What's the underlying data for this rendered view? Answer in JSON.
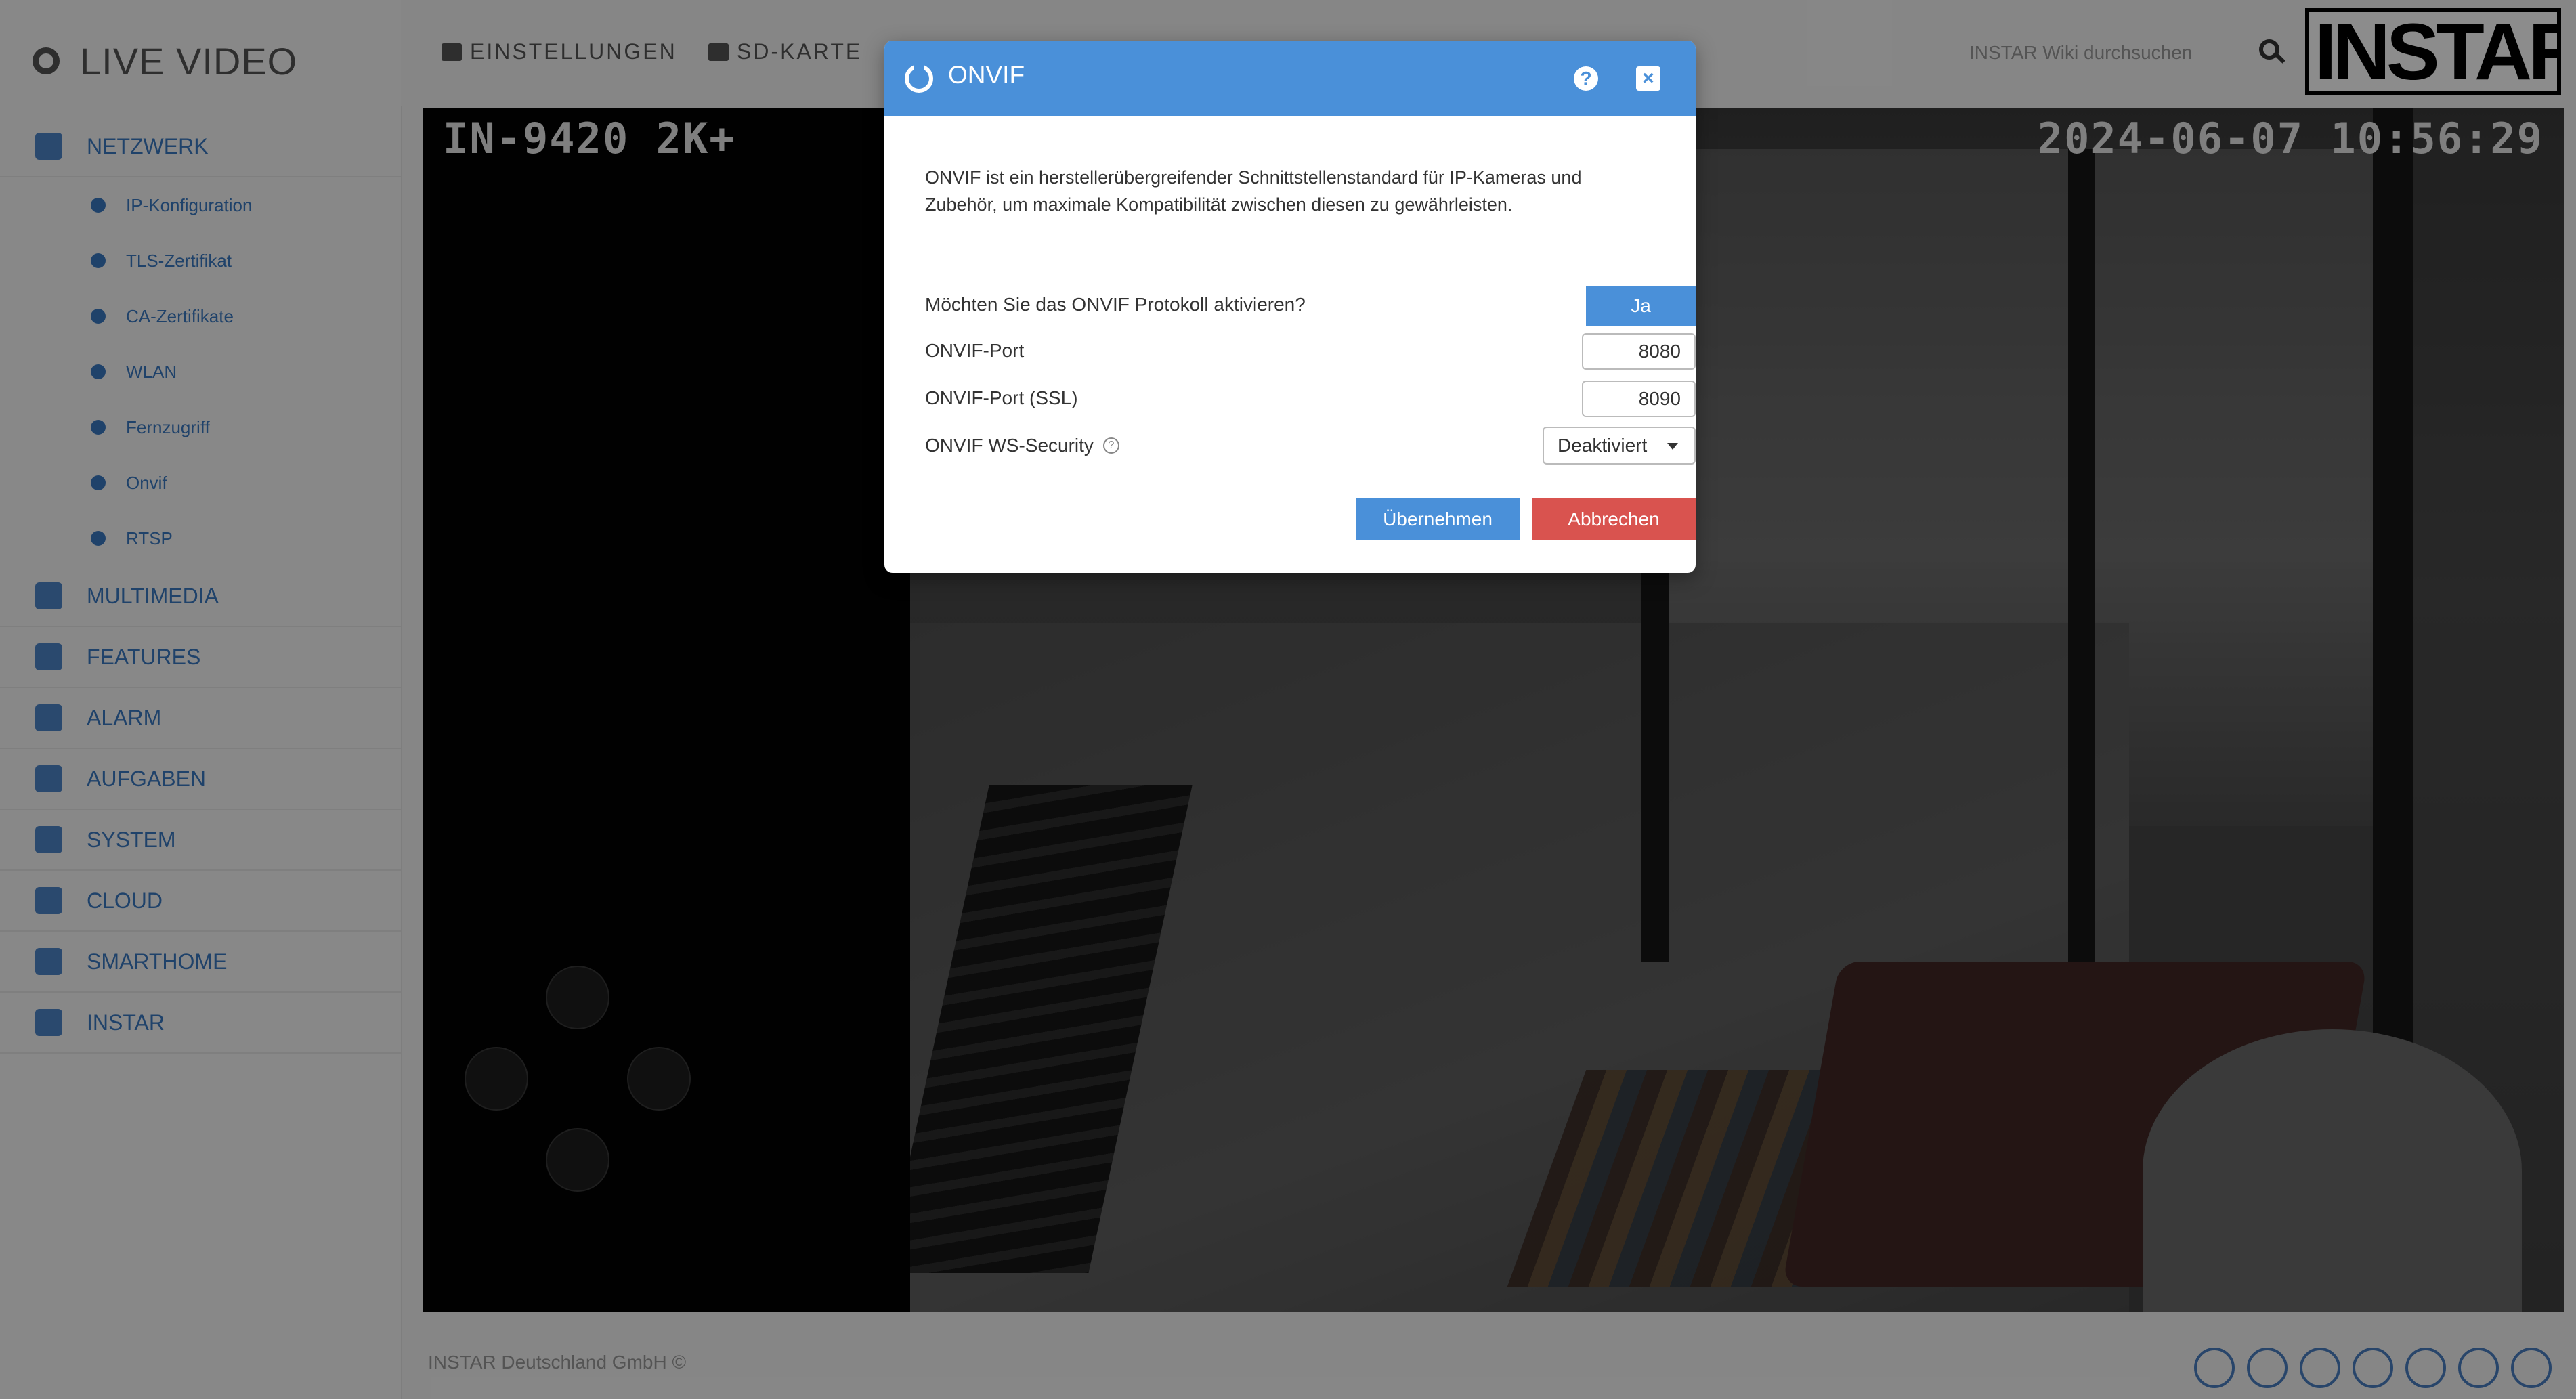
{
  "sidebar": {
    "brand": "LIVE VIDEO",
    "sections": [
      {
        "label": "NETZWERK",
        "icon": "network-icon"
      },
      {
        "label": "MULTIMEDIA",
        "icon": "image-icon"
      },
      {
        "label": "FEATURES",
        "icon": "features-icon"
      },
      {
        "label": "ALARM",
        "icon": "bell-icon"
      },
      {
        "label": "AUFGABEN",
        "icon": "calendar-icon"
      },
      {
        "label": "SYSTEM",
        "icon": "gear-icon"
      },
      {
        "label": "CLOUD",
        "icon": "cloud-icon"
      },
      {
        "label": "SMARTHOME",
        "icon": "smarthome-icon"
      },
      {
        "label": "INSTAR",
        "icon": "instar-icon"
      }
    ],
    "network_items": [
      {
        "label": "IP-Konfiguration"
      },
      {
        "label": "TLS-Zertifikat"
      },
      {
        "label": "CA-Zertifikate"
      },
      {
        "label": "WLAN"
      },
      {
        "label": "Fernzugriff"
      },
      {
        "label": "Onvif"
      },
      {
        "label": "RTSP"
      }
    ]
  },
  "topnav": {
    "settings": "EINSTELLUNGEN",
    "sdcard": "SD-KARTE",
    "search_text": "INSTAR Wiki durchsuchen",
    "logo": "INSTAR"
  },
  "video": {
    "camera_name": "IN-9420 2K+",
    "timestamp": "2024-06-07 10:56:29"
  },
  "footer": {
    "copyright": "INSTAR Deutschland GmbH ©"
  },
  "modal": {
    "title": "ONVIF",
    "help_glyph": "?",
    "close_glyph": "×",
    "description": "ONVIF ist ein herstellerübergreifender Schnittstellenstandard für IP-Kameras und Zubehör, um maximale Kompatibilität zwischen diesen zu gewährleisten.",
    "activate_label": "Möchten Sie das ONVIF Protokoll aktivieren?",
    "activate_value": "Ja",
    "port_label": "ONVIF-Port",
    "port_value": "8080",
    "ssl_port_label": "ONVIF-Port (SSL)",
    "ssl_port_value": "8090",
    "ws_security_label": "ONVIF WS-Security",
    "ws_security_value": "Deaktiviert",
    "apply_label": "Übernehmen",
    "cancel_label": "Abbrechen"
  },
  "colors": {
    "accent": "#4a90d9",
    "danger": "#d9534f"
  }
}
